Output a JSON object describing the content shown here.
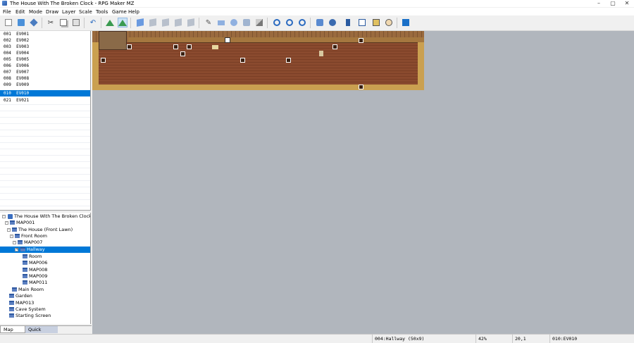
{
  "window": {
    "title": "The House With The Broken Clock - RPG Maker MZ"
  },
  "menu": [
    "File",
    "Edit",
    "Mode",
    "Draw",
    "Layer",
    "Scale",
    "Tools",
    "Game",
    "Help"
  ],
  "toolbar": {
    "buttons": [
      {
        "name": "new-project",
        "icon": "new-file-icon"
      },
      {
        "name": "open-project",
        "icon": "folder-open-icon"
      },
      {
        "name": "save-project",
        "icon": "save-icon"
      },
      {
        "name": "cut",
        "icon": "scissors-icon"
      },
      {
        "name": "copy",
        "icon": "copy-icon"
      },
      {
        "name": "paste",
        "icon": "paste-icon"
      },
      {
        "name": "undo",
        "icon": "undo-icon"
      },
      {
        "name": "map-mode",
        "icon": "mountain-icon"
      },
      {
        "name": "event-mode",
        "icon": "mountain-figure-icon"
      },
      {
        "name": "layer-1",
        "icon": "cube-icon"
      },
      {
        "name": "layer-2",
        "icon": "cube-icon"
      },
      {
        "name": "layer-3",
        "icon": "cube-icon"
      },
      {
        "name": "layer-4",
        "icon": "cube-icon"
      },
      {
        "name": "layer-auto",
        "icon": "cube-icon"
      },
      {
        "name": "pencil",
        "icon": "pencil-icon"
      },
      {
        "name": "rectangle",
        "icon": "rectangle-icon"
      },
      {
        "name": "ellipse",
        "icon": "ellipse-icon"
      },
      {
        "name": "fill",
        "icon": "fill-icon"
      },
      {
        "name": "shadow-pen",
        "icon": "shadow-pen-icon"
      },
      {
        "name": "zoom-in",
        "icon": "zoom-in-icon"
      },
      {
        "name": "zoom-out",
        "icon": "zoom-out-icon"
      },
      {
        "name": "zoom-actual",
        "icon": "zoom-actual-icon"
      },
      {
        "name": "database",
        "icon": "database-icon"
      },
      {
        "name": "plugin-manager",
        "icon": "plugin-icon"
      },
      {
        "name": "sound-test",
        "icon": "speaker-icon"
      },
      {
        "name": "event-searcher",
        "icon": "search-events-icon"
      },
      {
        "name": "resource-manager",
        "icon": "resource-icon"
      },
      {
        "name": "character-generator",
        "icon": "character-icon"
      },
      {
        "name": "playtest",
        "icon": "play-icon"
      }
    ]
  },
  "events": [
    {
      "id": "001",
      "name": "EV001"
    },
    {
      "id": "002",
      "name": "EV002"
    },
    {
      "id": "003",
      "name": "EV003"
    },
    {
      "id": "004",
      "name": "EV004"
    },
    {
      "id": "005",
      "name": "EV005"
    },
    {
      "id": "006",
      "name": "EV006"
    },
    {
      "id": "007",
      "name": "EV007"
    },
    {
      "id": "008",
      "name": "EV008"
    },
    {
      "id": "009",
      "name": "EV009"
    },
    {
      "id": "010",
      "name": "EV010"
    },
    {
      "id": "021",
      "name": "EV021"
    }
  ],
  "selected_event_index": 9,
  "map_tree": [
    {
      "label": "The House With The Broken Clock",
      "depth": 0,
      "type": "project",
      "expander": "-"
    },
    {
      "label": "MAP001",
      "depth": 1,
      "type": "map",
      "expander": "-"
    },
    {
      "label": "The House (Front Lawn)",
      "depth": 2,
      "type": "map",
      "expander": "-"
    },
    {
      "label": "Front Room",
      "depth": 3,
      "type": "map",
      "expander": "-"
    },
    {
      "label": "MAP007",
      "depth": 4,
      "type": "map",
      "expander": "-"
    },
    {
      "label": "Hallway",
      "depth": 5,
      "type": "map",
      "expander": "+",
      "selected": true
    },
    {
      "label": "Room",
      "depth": 6,
      "type": "map"
    },
    {
      "label": "MAP006",
      "depth": 6,
      "type": "map"
    },
    {
      "label": "MAP008",
      "depth": 6,
      "type": "map"
    },
    {
      "label": "MAP009",
      "depth": 6,
      "type": "map"
    },
    {
      "label": "MAP011",
      "depth": 6,
      "type": "map"
    },
    {
      "label": "Main Room",
      "depth": 3,
      "type": "map"
    },
    {
      "label": "Garden",
      "depth": 2,
      "type": "map"
    },
    {
      "label": "MAP013",
      "depth": 2,
      "type": "map"
    },
    {
      "label": "Cave System",
      "depth": 2,
      "type": "map"
    },
    {
      "label": "Starting Screen",
      "depth": 2,
      "type": "map"
    }
  ],
  "tabs": {
    "map_tree": "Map Tree",
    "quick_access": "Quick Access"
  },
  "status": {
    "map_info": "004:Hallway (50x9)",
    "zoom": "42%",
    "coords": "20,1",
    "event": "010:EV010"
  },
  "colors": {
    "selection": "#0078d7",
    "map_background": "#b1b6bd",
    "floor": "#8a4a2e",
    "border": "#caa050"
  }
}
